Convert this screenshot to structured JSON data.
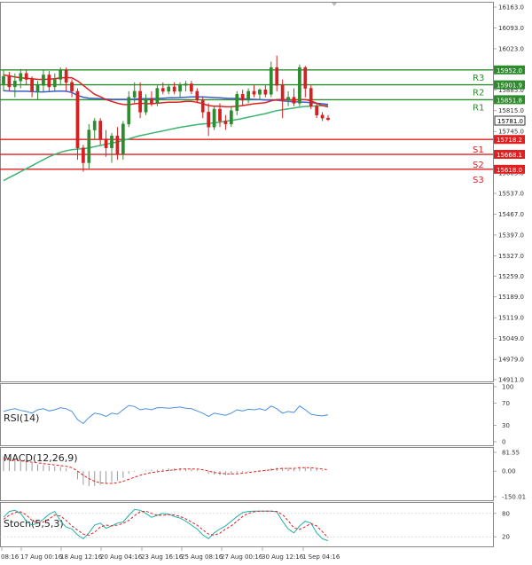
{
  "chart_data": {
    "type": "candlestick",
    "price_axis_labels": [
      "16163.0",
      "16093.0",
      "16023.0",
      "15953.0",
      "15885.0",
      "15815.0",
      "15745.0",
      "15675.0",
      "15605.0",
      "15537.0",
      "15467.0",
      "15397.0",
      "15327.0",
      "15259.0",
      "15189.0",
      "15119.0",
      "15049.0",
      "14979.0",
      "14911.0"
    ],
    "price_axis_range": [
      14911.0,
      16163.0
    ],
    "time_axis_labels": [
      "08:16",
      "17 Aug 00:16",
      "18 Aug 12:16",
      "20 Aug 04:16",
      "23 Aug 16:16",
      "25 Aug 08:16",
      "27 Aug 00:16",
      "30 Aug 12:16",
      "1 Sep 04:16"
    ],
    "current_price": "15781.0",
    "levels": [
      {
        "name": "R3",
        "value": 15952.0,
        "label": "15952.0",
        "color": "#2e8b2e"
      },
      {
        "name": "R2",
        "value": 15901.9,
        "label": "15901.9",
        "color": "#2e8b2e"
      },
      {
        "name": "R1",
        "value": 15851.8,
        "label": "15851.8",
        "color": "#2e8b2e"
      },
      {
        "name": "S1",
        "value": 15718.2,
        "label": "15718.2",
        "color": "#e02020"
      },
      {
        "name": "S2",
        "value": 15668.1,
        "label": "15668.1",
        "color": "#e02020"
      },
      {
        "name": "S3",
        "value": 15618.0,
        "label": "15618.0",
        "color": "#e02020"
      }
    ],
    "candles": [
      {
        "o": 15905,
        "h": 15950,
        "l": 15880,
        "c": 15930
      },
      {
        "o": 15930,
        "h": 15945,
        "l": 15880,
        "c": 15895
      },
      {
        "o": 15895,
        "h": 15940,
        "l": 15860,
        "c": 15915
      },
      {
        "o": 15915,
        "h": 15955,
        "l": 15890,
        "c": 15940
      },
      {
        "o": 15940,
        "h": 15952,
        "l": 15900,
        "c": 15920
      },
      {
        "o": 15920,
        "h": 15930,
        "l": 15860,
        "c": 15880
      },
      {
        "o": 15880,
        "h": 15915,
        "l": 15850,
        "c": 15900
      },
      {
        "o": 15900,
        "h": 15950,
        "l": 15880,
        "c": 15935
      },
      {
        "o": 15935,
        "h": 15948,
        "l": 15880,
        "c": 15895
      },
      {
        "o": 15895,
        "h": 15940,
        "l": 15880,
        "c": 15920
      },
      {
        "o": 15920,
        "h": 15960,
        "l": 15900,
        "c": 15950
      },
      {
        "o": 15950,
        "h": 15960,
        "l": 15880,
        "c": 15910
      },
      {
        "o": 15910,
        "h": 15920,
        "l": 15860,
        "c": 15880
      },
      {
        "o": 15880,
        "h": 15890,
        "l": 15650,
        "c": 15690
      },
      {
        "o": 15690,
        "h": 15700,
        "l": 15610,
        "c": 15640
      },
      {
        "o": 15640,
        "h": 15770,
        "l": 15620,
        "c": 15750
      },
      {
        "o": 15750,
        "h": 15790,
        "l": 15720,
        "c": 15780
      },
      {
        "o": 15780,
        "h": 15790,
        "l": 15700,
        "c": 15720
      },
      {
        "o": 15720,
        "h": 15750,
        "l": 15660,
        "c": 15690
      },
      {
        "o": 15690,
        "h": 15740,
        "l": 15640,
        "c": 15730
      },
      {
        "o": 15730,
        "h": 15760,
        "l": 15650,
        "c": 15670
      },
      {
        "o": 15670,
        "h": 15780,
        "l": 15650,
        "c": 15770
      },
      {
        "o": 15770,
        "h": 15880,
        "l": 15760,
        "c": 15860
      },
      {
        "o": 15860,
        "h": 15910,
        "l": 15840,
        "c": 15880
      },
      {
        "o": 15880,
        "h": 15910,
        "l": 15790,
        "c": 15810
      },
      {
        "o": 15810,
        "h": 15870,
        "l": 15800,
        "c": 15855
      },
      {
        "o": 15855,
        "h": 15880,
        "l": 15830,
        "c": 15840
      },
      {
        "o": 15840,
        "h": 15900,
        "l": 15830,
        "c": 15890
      },
      {
        "o": 15890,
        "h": 15910,
        "l": 15870,
        "c": 15880
      },
      {
        "o": 15880,
        "h": 15905,
        "l": 15870,
        "c": 15895
      },
      {
        "o": 15895,
        "h": 15910,
        "l": 15870,
        "c": 15880
      },
      {
        "o": 15880,
        "h": 15910,
        "l": 15860,
        "c": 15900
      },
      {
        "o": 15900,
        "h": 15915,
        "l": 15880,
        "c": 15905
      },
      {
        "o": 15905,
        "h": 15915,
        "l": 15870,
        "c": 15880
      },
      {
        "o": 15880,
        "h": 15890,
        "l": 15840,
        "c": 15850
      },
      {
        "o": 15850,
        "h": 15860,
        "l": 15790,
        "c": 15810
      },
      {
        "o": 15810,
        "h": 15840,
        "l": 15730,
        "c": 15760
      },
      {
        "o": 15760,
        "h": 15830,
        "l": 15750,
        "c": 15820
      },
      {
        "o": 15820,
        "h": 15840,
        "l": 15760,
        "c": 15780
      },
      {
        "o": 15780,
        "h": 15800,
        "l": 15750,
        "c": 15770
      },
      {
        "o": 15770,
        "h": 15830,
        "l": 15760,
        "c": 15815
      },
      {
        "o": 15815,
        "h": 15880,
        "l": 15800,
        "c": 15870
      },
      {
        "o": 15870,
        "h": 15885,
        "l": 15830,
        "c": 15850
      },
      {
        "o": 15850,
        "h": 15890,
        "l": 15840,
        "c": 15880
      },
      {
        "o": 15880,
        "h": 15900,
        "l": 15860,
        "c": 15870
      },
      {
        "o": 15870,
        "h": 15890,
        "l": 15850,
        "c": 15885
      },
      {
        "o": 15885,
        "h": 15900,
        "l": 15860,
        "c": 15870
      },
      {
        "o": 15870,
        "h": 15980,
        "l": 15860,
        "c": 15960
      },
      {
        "o": 15960,
        "h": 16000,
        "l": 15880,
        "c": 15900
      },
      {
        "o": 15900,
        "h": 15920,
        "l": 15790,
        "c": 15850
      },
      {
        "o": 15850,
        "h": 15880,
        "l": 15830,
        "c": 15860
      },
      {
        "o": 15860,
        "h": 15890,
        "l": 15830,
        "c": 15840
      },
      {
        "o": 15840,
        "h": 15970,
        "l": 15830,
        "c": 15960
      },
      {
        "o": 15960,
        "h": 15965,
        "l": 15860,
        "c": 15890
      },
      {
        "o": 15890,
        "h": 15900,
        "l": 15820,
        "c": 15830
      },
      {
        "o": 15830,
        "h": 15840,
        "l": 15790,
        "c": 15800
      },
      {
        "o": 15800,
        "h": 15810,
        "l": 15780,
        "c": 15790
      },
      {
        "o": 15790,
        "h": 15800,
        "l": 15780,
        "c": 15785
      }
    ],
    "ma_red": [
      15935,
      15932,
      15928,
      15925,
      15924,
      15922,
      15920,
      15920,
      15921,
      15922,
      15925,
      15926,
      15925,
      15915,
      15900,
      15885,
      15870,
      15862,
      15852,
      15846,
      15840,
      15836,
      15835,
      15838,
      15840,
      15839,
      15838,
      15840,
      15842,
      15843,
      15843,
      15844,
      15846,
      15846,
      15843,
      15838,
      15832,
      15830,
      15830,
      15828,
      15828,
      15830,
      15832,
      15835,
      15838,
      15840,
      15842,
      15848,
      15852,
      15852,
      15852,
      15850,
      15852,
      15852,
      15848,
      15840,
      15832,
      15828
    ],
    "ma_blue": [
      15882,
      15881,
      15880,
      15880,
      15880,
      15879,
      15878,
      15878,
      15879,
      15880,
      15881,
      15880,
      15876,
      15866,
      15860,
      15857,
      15856,
      15855,
      15854,
      15853,
      15853,
      15853,
      15853,
      15854,
      15855,
      15855,
      15855,
      15856,
      15857,
      15858,
      15858,
      15859,
      15860,
      15861,
      15861,
      15861,
      15860,
      15859,
      15858,
      15857,
      15856,
      15856,
      15855,
      15854,
      15853,
      15852,
      15851,
      15851,
      15850,
      15848,
      15846,
      15845,
      15844,
      15843,
      15842,
      15840,
      15838,
      15836
    ],
    "ma_green": [
      15580,
      15590,
      15600,
      15610,
      15620,
      15630,
      15640,
      15650,
      15660,
      15668,
      15675,
      15680,
      15684,
      15686,
      15687,
      15690,
      15694,
      15698,
      15702,
      15706,
      15710,
      15715,
      15720,
      15726,
      15731,
      15735,
      15739,
      15743,
      15747,
      15751,
      15755,
      15759,
      15762,
      15765,
      15768,
      15770,
      15772,
      15774,
      15776,
      15779,
      15782,
      15785,
      15789,
      15793,
      15797,
      15801,
      15805,
      15810,
      15815,
      15818,
      15821,
      15824,
      15827,
      15829,
      15830,
      15831,
      15832,
      15833
    ],
    "rsi": {
      "title": "RSI(14)",
      "axis_labels": [
        "100",
        "70",
        "30",
        "0"
      ],
      "range": [
        0,
        100
      ],
      "values": [
        55,
        58,
        60,
        57,
        55,
        52,
        58,
        60,
        56,
        58,
        62,
        60,
        55,
        40,
        33,
        44,
        52,
        50,
        46,
        52,
        50,
        58,
        66,
        64,
        58,
        60,
        58,
        62,
        62,
        61,
        62,
        63,
        61,
        60,
        56,
        52,
        46,
        52,
        50,
        48,
        52,
        58,
        56,
        59,
        58,
        60,
        57,
        65,
        60,
        52,
        55,
        53,
        65,
        58,
        50,
        48,
        47,
        49
      ]
    },
    "macd": {
      "title": "MACD(12,26,9)",
      "axis_labels": [
        "81.55",
        "0.00",
        "-150.01"
      ],
      "range": [
        -150.01,
        81.55
      ],
      "histogram": [
        22,
        20,
        18,
        16,
        14,
        12,
        10,
        9,
        8,
        7,
        6,
        4,
        0,
        -12,
        -20,
        -22,
        -22,
        -20,
        -18,
        -16,
        -14,
        -10,
        -4,
        -1,
        0,
        1,
        2,
        2,
        3,
        4,
        4,
        4,
        4,
        3,
        2,
        0,
        -4,
        -5,
        -6,
        -6,
        -5,
        -3,
        -2,
        -1,
        0,
        1,
        2,
        4,
        5,
        5,
        5,
        4,
        6,
        6,
        5,
        3,
        1,
        0
      ],
      "signal": [
        18,
        17,
        16,
        15,
        14,
        13,
        12,
        11,
        10,
        9,
        8,
        7,
        5,
        0,
        -6,
        -11,
        -15,
        -17,
        -18,
        -18,
        -17,
        -15,
        -12,
        -9,
        -6,
        -4,
        -2,
        -1,
        0,
        1,
        2,
        3,
        3,
        3,
        3,
        2,
        0,
        -2,
        -3,
        -4,
        -4,
        -4,
        -3,
        -2,
        -1,
        0,
        1,
        2,
        3,
        4,
        4,
        4,
        5,
        5,
        5,
        4,
        3,
        2
      ]
    },
    "stoch": {
      "title": "Stoch(5,5,3)",
      "axis_labels": [
        "80",
        "20"
      ],
      "range": [
        0,
        100
      ],
      "k": [
        70,
        85,
        88,
        80,
        60,
        50,
        55,
        65,
        78,
        85,
        60,
        45,
        40,
        25,
        15,
        30,
        50,
        55,
        42,
        48,
        55,
        58,
        75,
        90,
        88,
        80,
        70,
        75,
        80,
        78,
        72,
        68,
        60,
        50,
        40,
        25,
        15,
        30,
        40,
        48,
        60,
        72,
        82,
        85,
        86,
        86,
        86,
        86,
        84,
        60,
        40,
        30,
        48,
        60,
        55,
        30,
        15,
        10
      ],
      "d": [
        65,
        75,
        82,
        84,
        76,
        62,
        55,
        58,
        66,
        76,
        73,
        62,
        48,
        37,
        27,
        24,
        32,
        45,
        50,
        48,
        50,
        54,
        62,
        74,
        84,
        86,
        80,
        75,
        75,
        77,
        76,
        72,
        66,
        58,
        50,
        38,
        27,
        24,
        29,
        40,
        48,
        60,
        72,
        80,
        84,
        86,
        86,
        86,
        85,
        77,
        61,
        43,
        39,
        46,
        54,
        48,
        33,
        18
      ]
    }
  }
}
